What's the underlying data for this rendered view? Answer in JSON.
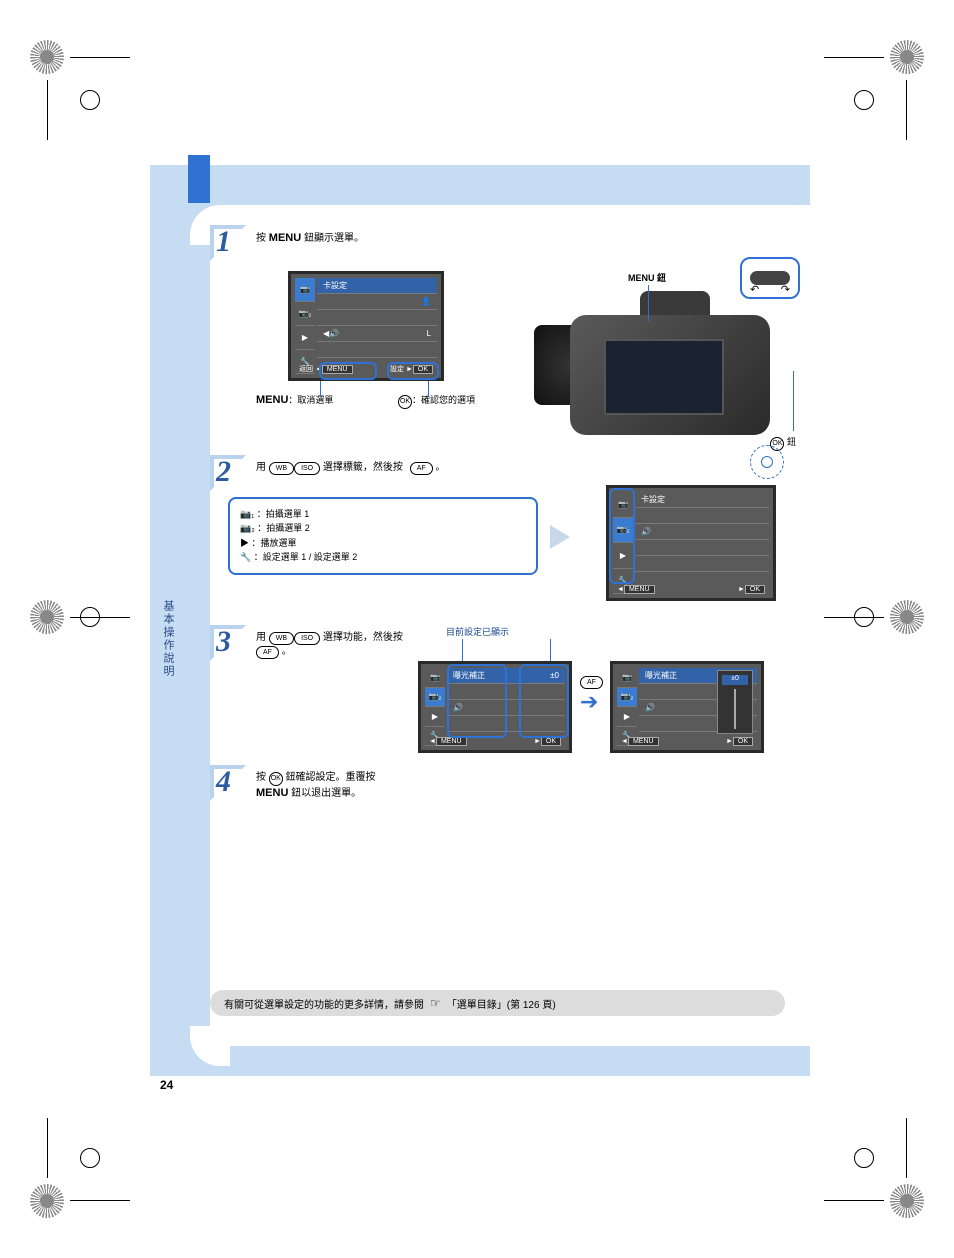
{
  "page_number": "24",
  "side_tab": "基本操作說明",
  "step1": {
    "title_prefix": "按",
    "title_button": "MENU",
    "title_suffix": "鈕顯示選單。",
    "caption_menu": "MENU",
    "caption_menu_text": "：取消選單",
    "caption_ok_text": "：確認您的選項",
    "camera_menu_label": "MENU",
    "camera_ok_label": "鈕",
    "ok_label": "i",
    "lcd": {
      "tabs": [
        "W",
        "X",
        "Y",
        "Z"
      ],
      "rows": [
        {
          "l": "卡設定",
          "r": ""
        },
        {
          "l": "",
          "r": "j"
        },
        {
          "l": "",
          "r": "K"
        },
        {
          "l": "",
          "r": ""
        },
        {
          "l": "",
          "r": ""
        }
      ],
      "foot_left": "返回",
      "foot_left_btn": "MENU",
      "foot_right": "設定",
      "foot_right_btn": "OK"
    }
  },
  "step2": {
    "text_a": "用",
    "text_b": "選擇標籤，然後按",
    "text_c": "。",
    "tabs": {
      "t1": "：拍攝選單 1",
      "t2": "：拍攝選單 2",
      "t3": "：播放選單",
      "t4": "：設定選單 1 / 設定選單 2"
    },
    "lcd_rows": [
      "卡設定",
      "",
      "",
      "",
      ""
    ]
  },
  "step3": {
    "text_a": "用",
    "text_b": "選擇功能，然後按",
    "text_c": "。",
    "callout": "目前設定已顯示",
    "lcd_l_rows": [
      "曝光補正",
      "",
      "",
      "",
      ""
    ],
    "lcd_r_rows": [
      "曝光補正",
      "",
      "",
      "",
      ""
    ],
    "between_icon": "p"
  },
  "step4": {
    "text_a": "按",
    "text_b": "鈕確認設定。重覆按",
    "text_c": "MENU",
    "text_d": "鈕以退出選單。"
  },
  "footbar": {
    "text": "有關可從選單設定的功能的更多詳情，請參閱",
    "link": "「選單目錄」(第 126 頁)",
    "icon": "g"
  }
}
